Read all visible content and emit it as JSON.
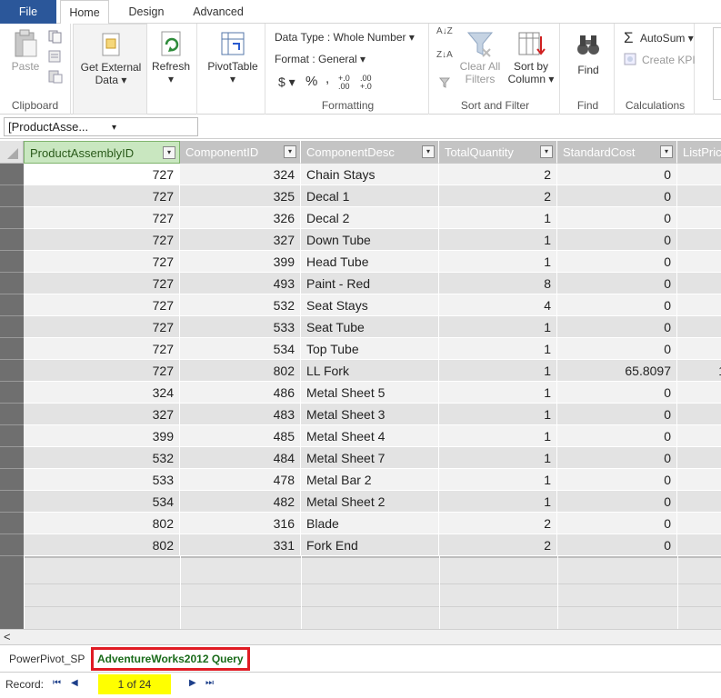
{
  "ribbon_tabs": [
    "File",
    "Home",
    "Design",
    "Advanced"
  ],
  "clipboard": {
    "paste": "Paste",
    "label": "Clipboard"
  },
  "get_data": {
    "get_external_line1": "Get External",
    "get_external_line2": "Data ▾",
    "refresh": "Refresh",
    "refresh_arrow": "▾",
    "pivot": "PivotTable",
    "pivot_arrow": "▾"
  },
  "formatting": {
    "data_type": "Data Type : Whole Number ▾",
    "format": "Format : General ▾",
    "currency": "$ ▾",
    "percent": "%",
    "comma": ",",
    "inc_dec": "+.0 .00",
    "dec_dec": ".00 +.0",
    "label": "Formatting"
  },
  "sort_filter": {
    "sort_az": "A↓Z",
    "sort_za": "Z↓A",
    "clear_line1": "Clear All",
    "clear_line2": "Filters",
    "sortcol_line1": "Sort by",
    "sortcol_line2": "Column ▾",
    "label": "Sort and Filter"
  },
  "find": {
    "button": "Find",
    "label": "Find"
  },
  "calculations": {
    "autosum": "AutoSum ▾",
    "create_kpi": "Create KPI",
    "label": "Calculations"
  },
  "namebox": {
    "value": "[ProductAsse...",
    "arrow": "▾"
  },
  "columns": [
    "ProductAssemblyID",
    "ComponentID",
    "ComponentDesc",
    "TotalQuantity",
    "StandardCost",
    "ListPrice"
  ],
  "rows": [
    [
      "727",
      "324",
      "Chain Stays",
      "2",
      "0",
      ""
    ],
    [
      "727",
      "325",
      "Decal 1",
      "2",
      "0",
      ""
    ],
    [
      "727",
      "326",
      "Decal 2",
      "1",
      "0",
      ""
    ],
    [
      "727",
      "327",
      "Down Tube",
      "1",
      "0",
      ""
    ],
    [
      "727",
      "399",
      "Head Tube",
      "1",
      "0",
      ""
    ],
    [
      "727",
      "493",
      "Paint - Red",
      "8",
      "0",
      ""
    ],
    [
      "727",
      "532",
      "Seat Stays",
      "4",
      "0",
      ""
    ],
    [
      "727",
      "533",
      "Seat Tube",
      "1",
      "0",
      ""
    ],
    [
      "727",
      "534",
      "Top Tube",
      "1",
      "0",
      ""
    ],
    [
      "727",
      "802",
      "LL Fork",
      "1",
      "65.8097",
      "1"
    ],
    [
      "324",
      "486",
      "Metal Sheet 5",
      "1",
      "0",
      ""
    ],
    [
      "327",
      "483",
      "Metal Sheet 3",
      "1",
      "0",
      ""
    ],
    [
      "399",
      "485",
      "Metal Sheet 4",
      "1",
      "0",
      ""
    ],
    [
      "532",
      "484",
      "Metal Sheet 7",
      "1",
      "0",
      ""
    ],
    [
      "533",
      "478",
      "Metal Bar 2",
      "1",
      "0",
      ""
    ],
    [
      "534",
      "482",
      "Metal Sheet 2",
      "1",
      "0",
      ""
    ],
    [
      "802",
      "316",
      "Blade",
      "2",
      "0",
      ""
    ],
    [
      "802",
      "331",
      "Fork End",
      "2",
      "0",
      ""
    ]
  ],
  "sheets": [
    "PowerPivot_SP",
    "AdventureWorks2012 Query"
  ],
  "record": {
    "label": "Record:",
    "value": "1 of 24",
    "first": "⏮",
    "prev": "◀",
    "next": "▶",
    "last": "⏭"
  },
  "scroll_left": "<"
}
